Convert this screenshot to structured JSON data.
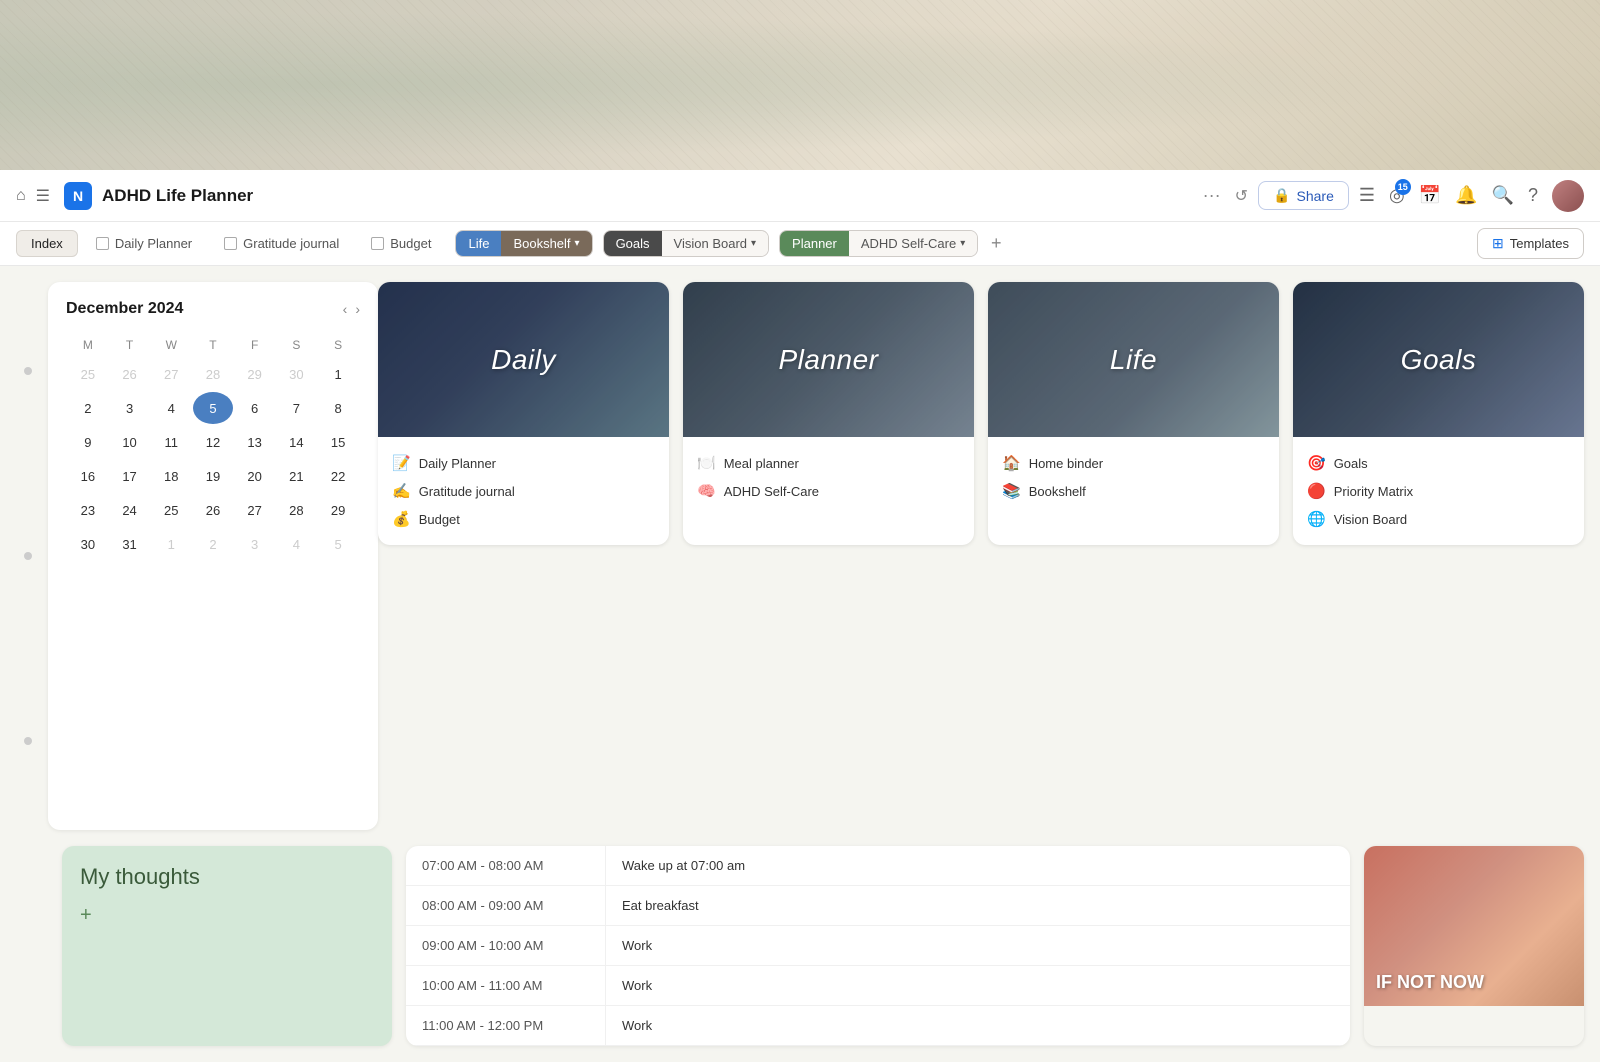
{
  "app": {
    "title": "ADHD Life Planner",
    "logo_letter": "N"
  },
  "nav": {
    "share_label": "Share",
    "share_icon": "🔒",
    "badge_count": "15",
    "templates_label": "Templates"
  },
  "tabs": {
    "index_label": "Index",
    "daily_planner_label": "Daily Planner",
    "gratitude_label": "Gratitude journal",
    "budget_label": "Budget",
    "life_label": "Life",
    "bookshelf_label": "Bookshelf",
    "goals_label": "Goals",
    "vision_board_label": "Vision Board",
    "planner_label": "Planner",
    "adhd_label": "ADHD Self-Care",
    "plus_label": "+"
  },
  "calendar": {
    "title": "December 2024",
    "days_of_week": [
      "M",
      "T",
      "W",
      "T",
      "F",
      "S",
      "S"
    ],
    "weeks": [
      [
        "25",
        "26",
        "27",
        "28",
        "29",
        "30",
        "1"
      ],
      [
        "2",
        "3",
        "4",
        "5",
        "6",
        "7",
        "8"
      ],
      [
        "9",
        "10",
        "11",
        "12",
        "13",
        "14",
        "15"
      ],
      [
        "16",
        "17",
        "18",
        "19",
        "20",
        "21",
        "22"
      ],
      [
        "23",
        "24",
        "25",
        "26",
        "27",
        "28",
        "29"
      ],
      [
        "30",
        "31",
        "1",
        "2",
        "3",
        "4",
        "5"
      ]
    ],
    "today": "5",
    "today_row": 1,
    "today_col": 3,
    "prev_icon": "‹",
    "next_icon": "›"
  },
  "cards": [
    {
      "id": "daily",
      "label": "Daily",
      "bg_class": "daily-bg",
      "items": [
        {
          "emoji": "📝",
          "text": "Daily Planner"
        },
        {
          "emoji": "✍️",
          "text": "Gratitude journal"
        },
        {
          "emoji": "💰",
          "text": "Budget"
        }
      ]
    },
    {
      "id": "planner",
      "label": "Planner",
      "bg_class": "planner-bg",
      "items": [
        {
          "emoji": "🍽️",
          "text": "Meal planner"
        },
        {
          "emoji": "🧠",
          "text": "ADHD Self-Care"
        }
      ]
    },
    {
      "id": "life",
      "label": "Life",
      "bg_class": "life-bg",
      "items": [
        {
          "emoji": "🏠",
          "text": "Home binder"
        },
        {
          "emoji": "📚",
          "text": "Bookshelf"
        }
      ]
    },
    {
      "id": "goals",
      "label": "Goals",
      "bg_class": "goals-bg",
      "items": [
        {
          "emoji": "🎯",
          "text": "Goals"
        },
        {
          "emoji": "🔴",
          "text": "Priority Matrix"
        },
        {
          "emoji": "🌐",
          "text": "Vision Board"
        }
      ]
    }
  ],
  "thoughts": {
    "title": "My thoughts",
    "add_label": "+"
  },
  "schedule": {
    "rows": [
      {
        "time": "07:00 AM - 08:00 AM",
        "task": "Wake up at 07:00 am"
      },
      {
        "time": "08:00 AM - 09:00 AM",
        "task": "Eat breakfast"
      },
      {
        "time": "09:00 AM - 10:00 AM",
        "task": "Work"
      },
      {
        "time": "10:00 AM - 11:00 AM",
        "task": "Work"
      },
      {
        "time": "11:00 AM - 12:00 PM",
        "task": "Work"
      }
    ]
  },
  "vision": {
    "text": "IF NOT NOW"
  }
}
